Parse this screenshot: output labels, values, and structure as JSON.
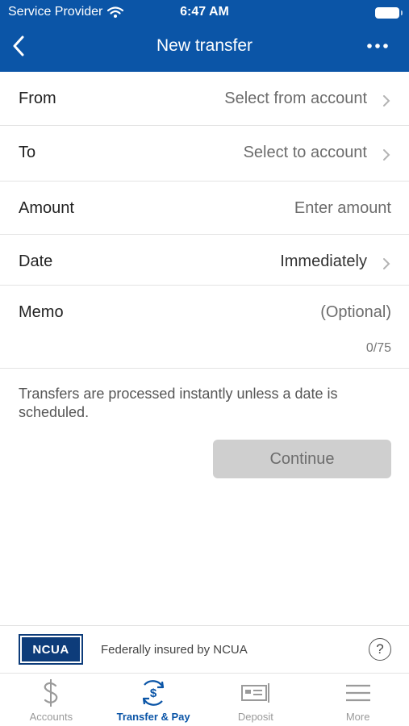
{
  "status_bar": {
    "carrier": "Service Provider",
    "time": "6:47 AM"
  },
  "nav": {
    "title": "New transfer"
  },
  "form": {
    "from": {
      "label": "From",
      "value": "Select from account"
    },
    "to": {
      "label": "To",
      "value": "Select to account"
    },
    "amount": {
      "label": "Amount",
      "placeholder": "Enter amount"
    },
    "date": {
      "label": "Date",
      "value": "Immediately"
    },
    "memo": {
      "label": "Memo",
      "placeholder": "(Optional)",
      "counter": "0/75"
    }
  },
  "note": "Transfers are processed instantly unless a date is scheduled.",
  "continue_label": "Continue",
  "ncua": {
    "logo_text": "NCUA",
    "text": "Federally insured by NCUA",
    "help": "?"
  },
  "tabs": [
    {
      "label": "Accounts",
      "icon": "dollar-icon"
    },
    {
      "label": "Transfer & Pay",
      "icon": "transfer-pay-icon",
      "active": true
    },
    {
      "label": "Deposit",
      "icon": "check-deposit-icon"
    },
    {
      "label": "More",
      "icon": "menu-icon"
    }
  ],
  "colors": {
    "brand": "#0b55a7",
    "button_disabled": "#cfcfcf"
  }
}
